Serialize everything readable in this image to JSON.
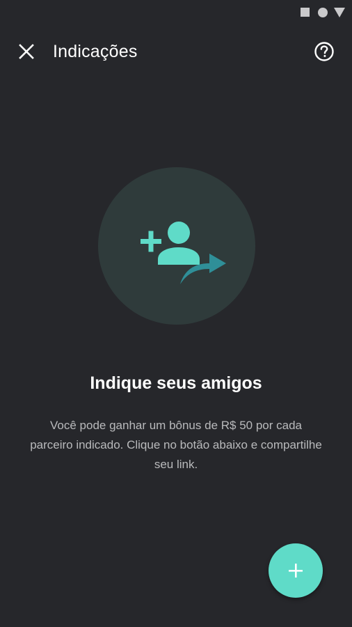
{
  "status_bar": {
    "icons": [
      "square-icon",
      "circle-icon",
      "triangle-icon"
    ]
  },
  "toolbar": {
    "title": "Indicações",
    "close_icon": "close-icon",
    "help_icon": "help-circle-icon"
  },
  "illustration": {
    "icon": "add-person-share-icon"
  },
  "content": {
    "heading": "Indique seus amigos",
    "description": "Você pode ganhar um bônus de R$ 50 por cada parceiro indicado. Clique no botão abaixo e compartilhe seu link."
  },
  "fab": {
    "icon": "plus-icon"
  },
  "colors": {
    "background": "#26272b",
    "accent": "#5fdbc8",
    "accent_dark": "#2f8f98",
    "illustration_bg": "#2f3b3b",
    "secondary_text": "#b9babc"
  }
}
